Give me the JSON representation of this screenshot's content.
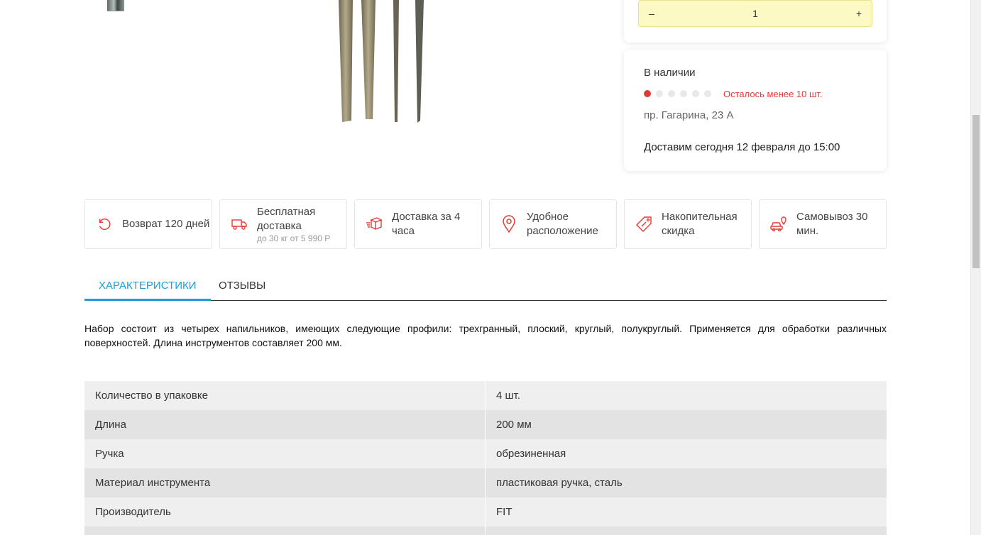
{
  "quantity": {
    "minus": "–",
    "value": "1",
    "plus": "+"
  },
  "stock": {
    "title": "В наличии",
    "level_filled": 1,
    "level_total": 6,
    "warning": "Осталось менее 10 шт.",
    "address": "пр. Гагарина, 23 А",
    "delivery": "Доставим сегодня 12 февраля до 15:00"
  },
  "features": [
    {
      "icon": "return-arrow-icon",
      "label": "Возврат 120 дней",
      "sub": ""
    },
    {
      "icon": "free-delivery-truck-icon",
      "label": "Бесплатная доставка",
      "sub": "до 30 кг от 5 990 Р"
    },
    {
      "icon": "fast-box-icon",
      "label": "Доставка за 4 часа",
      "sub": ""
    },
    {
      "icon": "location-pin-icon",
      "label": "Удобное расположение",
      "sub": ""
    },
    {
      "icon": "discount-tag-icon",
      "label": "Накопительная скидка",
      "sub": ""
    },
    {
      "icon": "car-pickup-icon",
      "label": "Самовывоз 30 мин.",
      "sub": ""
    }
  ],
  "tabs": [
    {
      "label": "Характеристики",
      "active": true
    },
    {
      "label": "Отзывы",
      "active": false
    }
  ],
  "description": "Набор состоит из четырех напильников, имеющих следующие профили: трехгранный, плоский, круглый, полукруглый. Применяется для обработки различных поверхностей. Длина инструментов составляет 200 мм.",
  "specs": [
    {
      "name": "Количество в упаковке",
      "value": "4 шт."
    },
    {
      "name": "Длина",
      "value": "200 мм"
    },
    {
      "name": "Ручка",
      "value": "обрезиненная"
    },
    {
      "name": "Материал инструмента",
      "value": "пластиковая ручка, сталь"
    },
    {
      "name": "Производитель",
      "value": "FIT"
    }
  ],
  "colors": {
    "accent": "#1a9fd8",
    "warning": "#e53935",
    "qty_bg": "#fdf9c4"
  }
}
